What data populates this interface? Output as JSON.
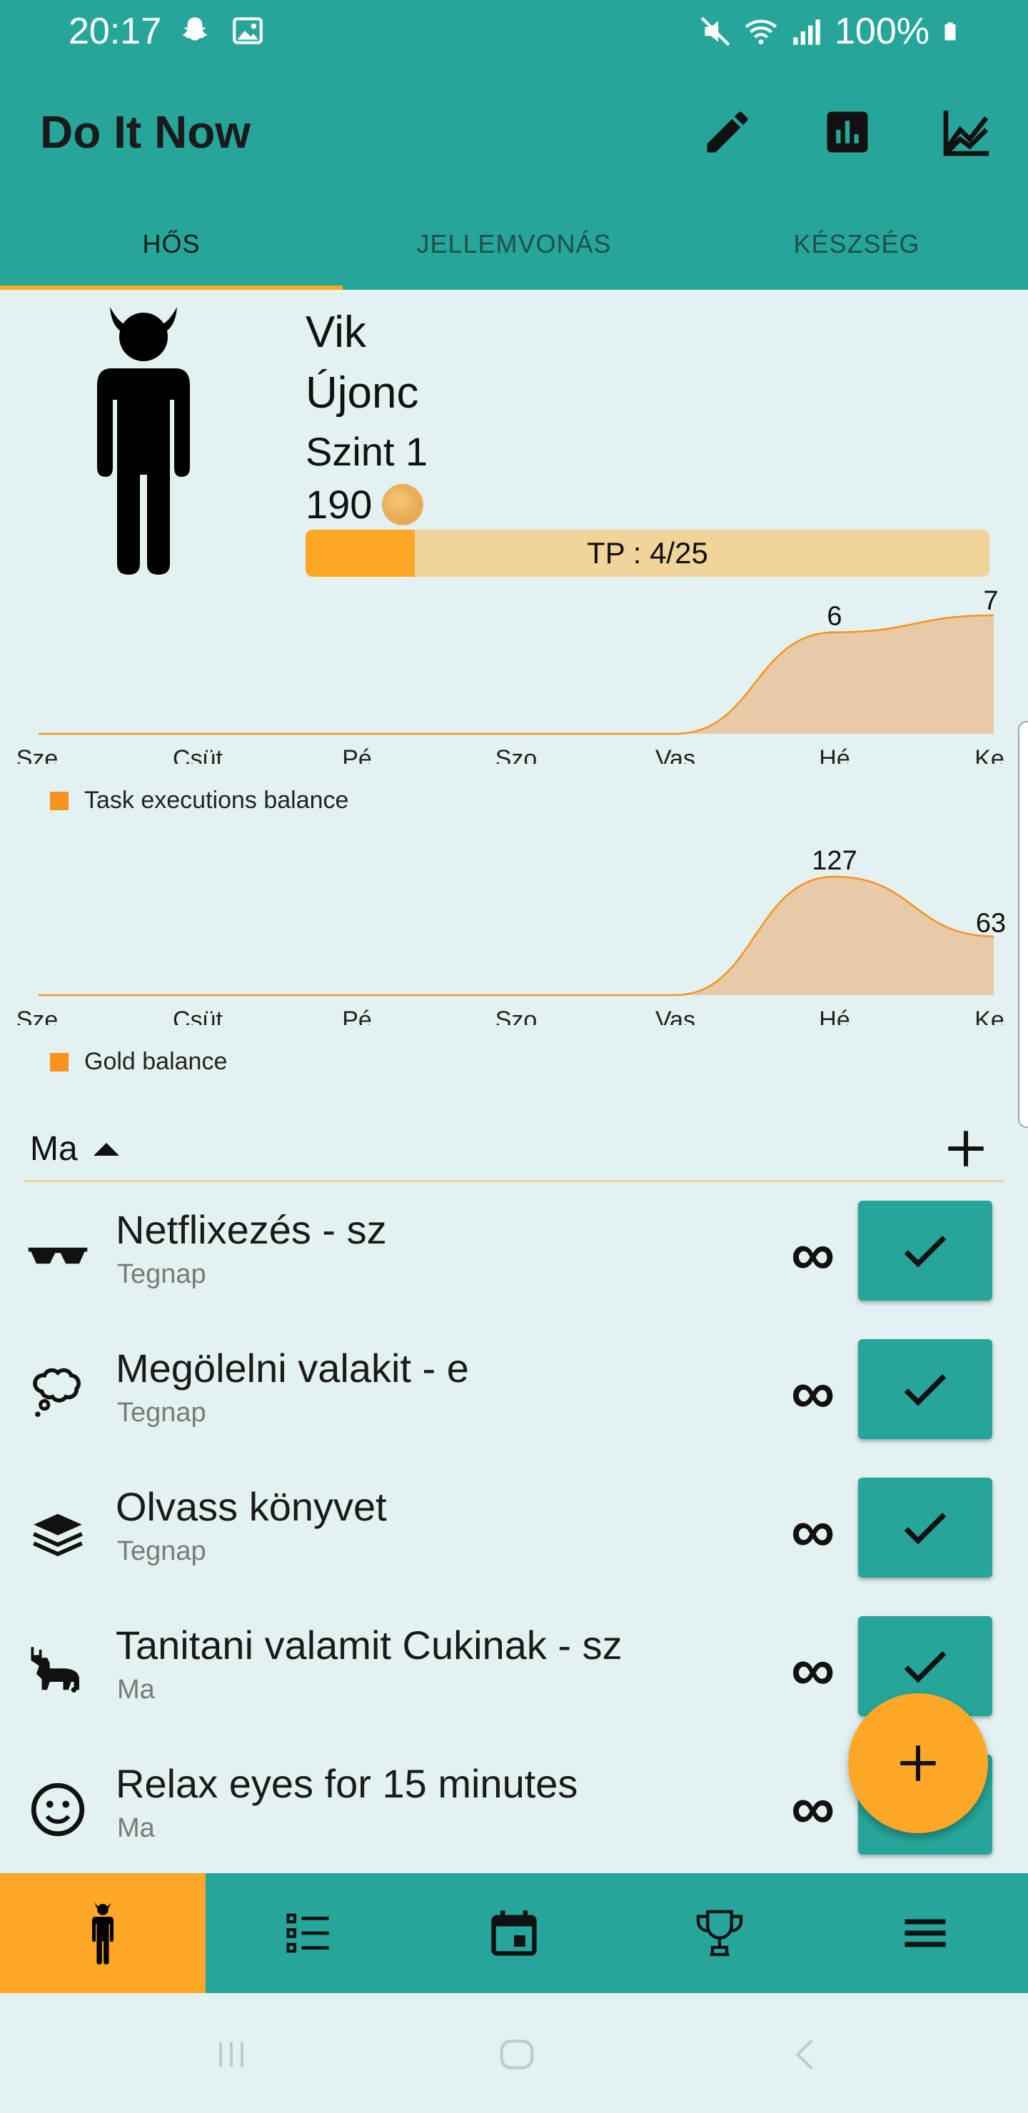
{
  "status_bar": {
    "time": "20:17",
    "battery": "100%"
  },
  "app": {
    "title": "Do It Now"
  },
  "toolbar": {
    "icons": [
      "pencil-icon",
      "bar-chart-icon",
      "line-chart-icon"
    ]
  },
  "tabs": [
    {
      "label": "HŐS",
      "active": true
    },
    {
      "label": "JELLEMVONÁS",
      "active": false
    },
    {
      "label": "KÉSZSÉG",
      "active": false
    }
  ],
  "hero": {
    "name": "Vik",
    "rank": "Újonc",
    "level": "Szint 1",
    "gold": "190",
    "xp_label": "TP : 4/25",
    "xp_fraction": 0.16
  },
  "charts": {
    "task_executions": {
      "chart_data": {
        "type": "area",
        "categories": [
          "Sze",
          "Csüt",
          "Pé",
          "Szo",
          "Vas",
          "Hé",
          "Ke"
        ],
        "series": [
          {
            "name": "Task executions balance",
            "values": [
              0,
              0,
              0,
              0,
              0,
              6,
              7
            ]
          }
        ],
        "data_labels": [
          "6",
          "7"
        ],
        "ylim": [
          0,
          7
        ],
        "grid": false,
        "legend": "bottom-left"
      }
    },
    "gold": {
      "chart_data": {
        "type": "area",
        "categories": [
          "Sze",
          "Csüt",
          "Pé",
          "Szo",
          "Vas",
          "Hé",
          "Ke"
        ],
        "series": [
          {
            "name": "Gold balance",
            "values": [
              0,
              0,
              0,
              0,
              0,
              127,
              63
            ]
          }
        ],
        "data_labels": [
          "127",
          "63"
        ],
        "ylim": [
          0,
          127
        ],
        "grid": false,
        "legend": "bottom-left"
      }
    }
  },
  "colors": {
    "primary": "#26a69a",
    "accent": "#ffa726",
    "chart_line": "#f7931e",
    "chart_fill": "#e8c9a8",
    "background": "#e3f2f1"
  },
  "list": {
    "sort_label": "Ma",
    "tasks": [
      {
        "name": "Netflixezés - sz",
        "sub": "Tegnap",
        "icon": "sunglasses-icon",
        "repeat": "∞"
      },
      {
        "name": "Megölelni valakit - e",
        "sub": "Tegnap",
        "icon": "thought-bubble-icon",
        "repeat": "∞"
      },
      {
        "name": "Olvass könyvet",
        "sub": "Tegnap",
        "icon": "book-stack-icon",
        "repeat": "∞"
      },
      {
        "name": "Tanitani valamit Cukinak - sz",
        "sub": "Ma",
        "icon": "moose-icon",
        "repeat": "∞"
      },
      {
        "name": "Relax eyes for 15 minutes",
        "sub": "Ma",
        "icon": "smiley-icon",
        "repeat": "∞"
      }
    ]
  },
  "bottom_nav": [
    "hero-nav-icon",
    "tasks-nav-icon",
    "calendar-nav-icon",
    "trophy-nav-icon",
    "menu-nav-icon"
  ]
}
